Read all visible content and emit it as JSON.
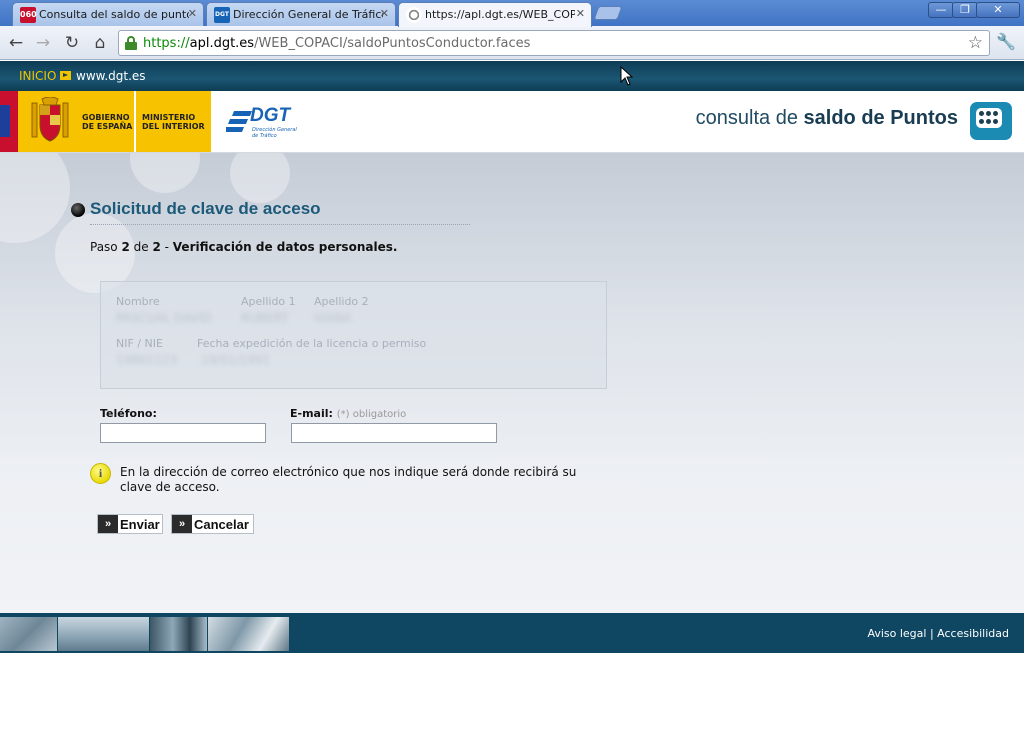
{
  "browser": {
    "tabs": [
      {
        "title": "Consulta del saldo de puntos d",
        "favicon_text": "060",
        "favicon_color": "#c8102e"
      },
      {
        "title": "Dirección General de Tráfico :",
        "favicon_text": "DGT",
        "favicon_color": "#1763b5"
      },
      {
        "title": "https://apl.dgt.es/WEB_COPA",
        "favicon_text": "",
        "favicon_color": "#888888"
      }
    ],
    "window_buttons": {
      "minimize": "—",
      "restore": "❐",
      "close": "✕"
    },
    "url": {
      "scheme": "https://",
      "host": "apl.dgt.es",
      "path": "/WEB_COPACI/saldoPuntosConductor.faces"
    }
  },
  "site": {
    "top_links": {
      "inicio": "INICIO",
      "dgt": "www.dgt.es"
    },
    "gov_logo": {
      "line1": "GOBIERNO",
      "line2": "DE ESPAÑA",
      "ministry1": "MINISTERIO",
      "ministry2": "DEL INTERIOR"
    },
    "dgt_logo": {
      "text": "DGT",
      "sub1": "Dirección General",
      "sub2": "de Tráfico"
    },
    "app_title_prefix": "consulta de ",
    "app_title_bold": "saldo de Puntos"
  },
  "main": {
    "section_title": "Solicitud de clave de acceso",
    "step": {
      "prefix": "Paso ",
      "current": "2",
      "of": " de ",
      "total": "2",
      "sep": " - ",
      "name": "Verificación de datos personales."
    },
    "personal_data": {
      "nombre_label": "Nombre",
      "apellido1_label": "Apellido 1",
      "apellido2_label": "Apellido 2",
      "nombre_value": "PASCUAL DAVID",
      "apellido1_value": "RUBERT",
      "apellido2_value": "VIANA",
      "nif_label": "NIF / NIE",
      "fecha_label": "Fecha expedición de la licencia o permiso",
      "nif_value": "19861123",
      "fecha_value": "19/01/1991"
    },
    "form": {
      "telefono_label": "Teléfono:",
      "telefono_value": "",
      "email_label": "E-mail:",
      "email_note": "(*) obligatorio",
      "email_value": ""
    },
    "info_message": "En la dirección de correo electrónico que nos indique será donde recibirá su clave de acceso.",
    "buttons": {
      "enviar": "Enviar",
      "cancelar": "Cancelar"
    }
  },
  "footer": {
    "aviso_legal": "Aviso legal",
    "separator": " | ",
    "accesibilidad": "Accesibilidad"
  },
  "colors": {
    "top_strip": "#1b5673",
    "title_blue": "#1c5a7a",
    "footer_bg": "#0f4762",
    "gov_yellow": "#f7c300"
  }
}
